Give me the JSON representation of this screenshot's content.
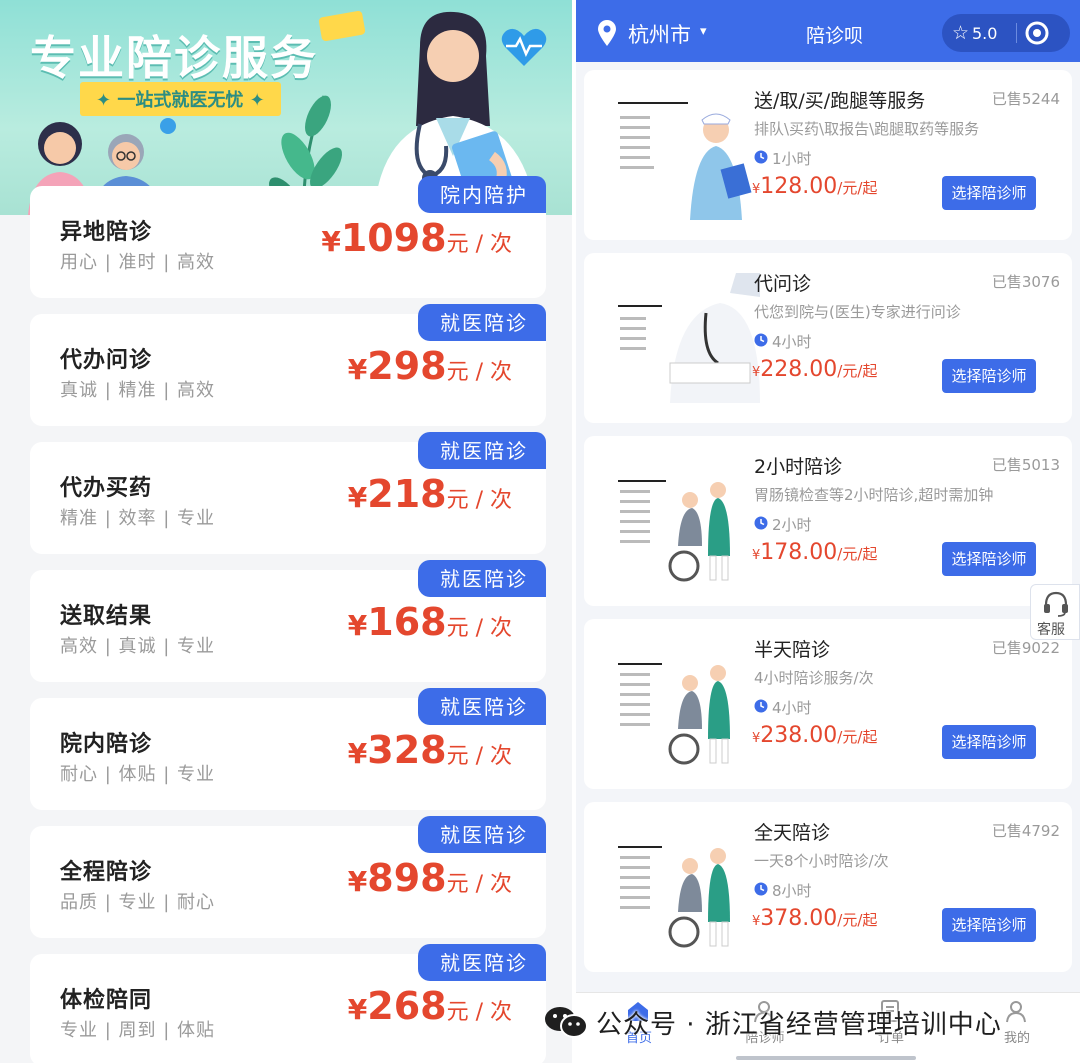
{
  "left_panel": {
    "banner": {
      "title": "专业陪诊服务",
      "subtitle": "✦ 一站式就医无忧 ✦"
    },
    "cards": [
      {
        "name": "异地陪诊",
        "desc": "用心 | 准时 | 高效",
        "tag": "院内陪护",
        "symbol": "¥",
        "price": "1098",
        "unit": "元 / 次"
      },
      {
        "name": "代办问诊",
        "desc": "真诚 | 精准 | 高效",
        "tag": "就医陪诊",
        "symbol": "¥",
        "price": "298",
        "unit": "元 / 次"
      },
      {
        "name": "代办买药",
        "desc": "精准 | 效率 | 专业",
        "tag": "就医陪诊",
        "symbol": "¥",
        "price": "218",
        "unit": "元 / 次"
      },
      {
        "name": "送取结果",
        "desc": "高效 | 真诚 | 专业",
        "tag": "就医陪诊",
        "symbol": "¥",
        "price": "168",
        "unit": "元 / 次"
      },
      {
        "name": "院内陪诊",
        "desc": "耐心 | 体贴 | 专业",
        "tag": "就医陪诊",
        "symbol": "¥",
        "price": "328",
        "unit": "元 / 次"
      },
      {
        "name": "全程陪诊",
        "desc": "品质 | 专业 | 耐心",
        "tag": "就医陪诊",
        "symbol": "¥",
        "price": "898",
        "unit": "元 / 次"
      },
      {
        "name": "体检陪同",
        "desc": "专业 | 周到 | 体贴",
        "tag": "就医陪诊",
        "symbol": "¥",
        "price": "268",
        "unit": "元 / 次"
      }
    ]
  },
  "right_panel": {
    "header": {
      "city": "杭州市",
      "caret": "▾",
      "title": "陪诊呗",
      "star": "☆",
      "rating": "5.0"
    },
    "services": [
      {
        "title": "送/取/买/跑腿等服务",
        "sold": "已售5244",
        "desc": "排队\\买药\\取报告\\跑腿取药等服务",
        "duration": "1小时",
        "symbol": "¥",
        "price": "128.00",
        "unit": "/元/起",
        "button": "选择陪诊师",
        "thumb_label": "送取买跑腿服务"
      },
      {
        "title": "代问诊",
        "sold": "已售3076",
        "desc": "代您到院与(医生)专家进行问诊",
        "duration": "4小时",
        "symbol": "¥",
        "price": "228.00",
        "unit": "/元/起",
        "button": "选择陪诊师",
        "thumb_label": "代问诊"
      },
      {
        "title": "2小时陪诊",
        "sold": "已售5013",
        "desc": "胃肠镜检查等2小时陪诊,超时需加钟",
        "duration": "2小时",
        "symbol": "¥",
        "price": "178.00",
        "unit": "/元/起",
        "button": "选择陪诊师",
        "thumb_label": "2小时陪诊"
      },
      {
        "title": "半天陪诊",
        "sold": "已售9022",
        "desc": "4小时陪诊服务/次",
        "duration": "4小时",
        "symbol": "¥",
        "price": "238.00",
        "unit": "/元/起",
        "button": "选择陪诊师",
        "thumb_label": "半天陪诊"
      },
      {
        "title": "全天陪诊",
        "sold": "已售4792",
        "desc": "一天8个小时陪诊/次",
        "duration": "8小时",
        "symbol": "¥",
        "price": "378.00",
        "unit": "/元/起",
        "button": "选择陪诊师",
        "thumb_label": "全天陪诊"
      }
    ],
    "customer_service": "客服",
    "tabbar": [
      {
        "label": "首页",
        "icon": "home-icon"
      },
      {
        "label": "陪诊师",
        "icon": "person-icon"
      },
      {
        "label": "订单",
        "icon": "order-icon"
      },
      {
        "label": "我的",
        "icon": "user-icon"
      }
    ]
  },
  "watermark": {
    "text": "公众号 · 浙江省经营管理培训中心"
  },
  "colors": {
    "accent_blue": "#3d6ce8",
    "price_red": "#e4472e",
    "banner_teal": "#8fe0d6"
  }
}
